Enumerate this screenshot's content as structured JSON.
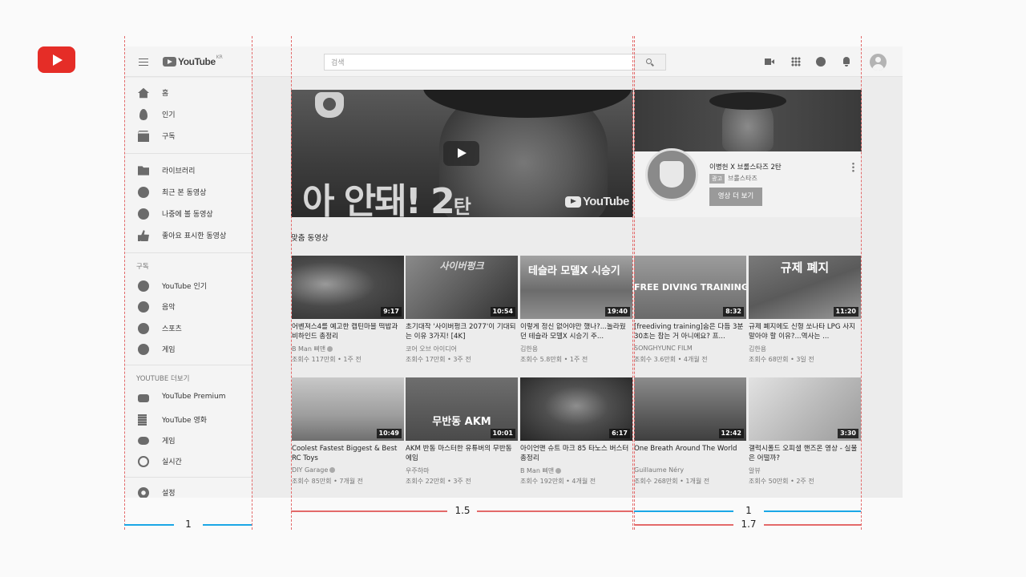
{
  "header": {
    "logo_text": "YouTube",
    "logo_region": "KR",
    "search_placeholder": "검색",
    "icons": [
      "hamburger-icon",
      "search-icon",
      "video-camera-icon",
      "apps-grid-icon",
      "messages-icon",
      "notifications-bell-icon",
      "account-avatar"
    ]
  },
  "sidebar": {
    "main_items": [
      {
        "icon": "home-icon",
        "label": "홈"
      },
      {
        "icon": "trending-fire-icon",
        "label": "인기"
      },
      {
        "icon": "subscriptions-icon",
        "label": "구독"
      }
    ],
    "library_items": [
      {
        "icon": "library-folder-icon",
        "label": "라이브러리"
      },
      {
        "icon": "history-icon",
        "label": "최근 본 동영상"
      },
      {
        "icon": "watch-later-clock-icon",
        "label": "나중에 볼 동영상"
      },
      {
        "icon": "liked-thumb-icon",
        "label": "좋아요 표시한 동영상"
      }
    ],
    "subscriptions_heading": "구독",
    "subscription_items": [
      {
        "icon": "youtube-popular-icon",
        "label": "YouTube 인기"
      },
      {
        "icon": "music-icon",
        "label": "음악"
      },
      {
        "icon": "sports-icon",
        "label": "스포츠"
      },
      {
        "icon": "gaming-icon",
        "label": "게임"
      }
    ],
    "more_heading": "YOUTUBE 더보기",
    "more_items": [
      {
        "icon": "youtube-premium-icon",
        "label": "YouTube Premium"
      },
      {
        "icon": "youtube-movies-icon",
        "label": "YouTube 영화"
      },
      {
        "icon": "gaming-controller-icon",
        "label": "게임"
      },
      {
        "icon": "live-icon",
        "label": "실시간"
      }
    ],
    "settings_item": {
      "icon": "settings-gear-icon",
      "label": "설정"
    }
  },
  "banner": {
    "title_main": "아 안돼!",
    "title_num": "2",
    "title_small": "탄",
    "brand_mark": "YouTube"
  },
  "ad": {
    "title": "이병헌 X 브롤스타즈 2탄",
    "badge": "광고",
    "channel": "브롤스타즈",
    "button_label": "영상 더 보기"
  },
  "recommended": {
    "section_title": "맞춤 동영상",
    "videos": [
      {
        "thumb_text": "",
        "duration": "9:17",
        "title": "어벤져스4를 예고한 캡틴마블 떡밥과 비하인드 총정리",
        "channel": "B Man 삐맨",
        "verified": true,
        "meta": "조회수 117만회 • 1주 전"
      },
      {
        "thumb_text": "사이버펑크",
        "duration": "10:54",
        "title": "초기대작 '사이버펑크 2077'이 기대되는 이유 3가지! [4K]",
        "channel": "코어 오브 아이디어",
        "verified": false,
        "meta": "조회수 17만회 • 3주 전"
      },
      {
        "thumb_text": "테슬라 모델X 시승기",
        "duration": "19:40",
        "title": "이렇게 정신 없어야만 했나?...놀라웠던 테슬라 모델X 시승기 주...",
        "channel": "김한용",
        "verified": false,
        "meta": "조회수 5.8만회 • 1주 전"
      },
      {
        "thumb_text": "FREE DIVING TRAINING",
        "duration": "8:32",
        "title": "[freediving training]숨은 다듬 3분 30초는 참는 거 아니에요? 프...",
        "channel": "SONGHYUNC FILM",
        "verified": false,
        "meta": "조회수 3.6만회 • 4개월 전"
      },
      {
        "thumb_text": "규제 폐지",
        "duration": "11:20",
        "title": "규제 폐지에도 신형 쏘나타 LPG 사지 말아야 할 이유?...역사는 ...",
        "channel": "김한용",
        "verified": false,
        "meta": "조회수 68만회 • 3일 전"
      },
      {
        "thumb_text": "",
        "duration": "10:49",
        "title": "Coolest Fastest Biggest & Best RC Toys",
        "channel": "DIY Garage",
        "verified": true,
        "meta": "조회수 85만회 • 7개월 전"
      },
      {
        "thumb_text": "무반동 AKM",
        "duration": "10:01",
        "title": "AKM 반동 마스터한 유튜버의 무반동 에임",
        "channel": "우주하마",
        "verified": false,
        "meta": "조회수 22만회 • 3주 전"
      },
      {
        "thumb_text": "",
        "duration": "6:17",
        "title": "아이언맨 슈트 마크 85 타노스 버스터 총정리",
        "channel": "B Man 삐맨",
        "verified": true,
        "meta": "조회수 192만회 • 4개월 전"
      },
      {
        "thumb_text": "",
        "duration": "12:42",
        "title": "One Breath Around The World",
        "channel": "Guillaume Néry",
        "verified": false,
        "meta": "조회수 268만회 • 1개월 전"
      },
      {
        "thumb_text": "",
        "duration": "3:30",
        "title": "갤럭시폴드 오피셜 핸즈온 영상 - 실물은 어떨까?",
        "channel": "알뷰",
        "verified": false,
        "meta": "조회수 50만회 • 2주 전"
      }
    ]
  },
  "measurements": {
    "sidebar_ratio": "1",
    "content_ratio": "1.5",
    "right_ratio_blue": "1",
    "right_ratio_red": "1.7",
    "colors": {
      "red": "#e36a6a",
      "blue": "#1aa7e6",
      "brand_red": "#e52d27"
    }
  }
}
